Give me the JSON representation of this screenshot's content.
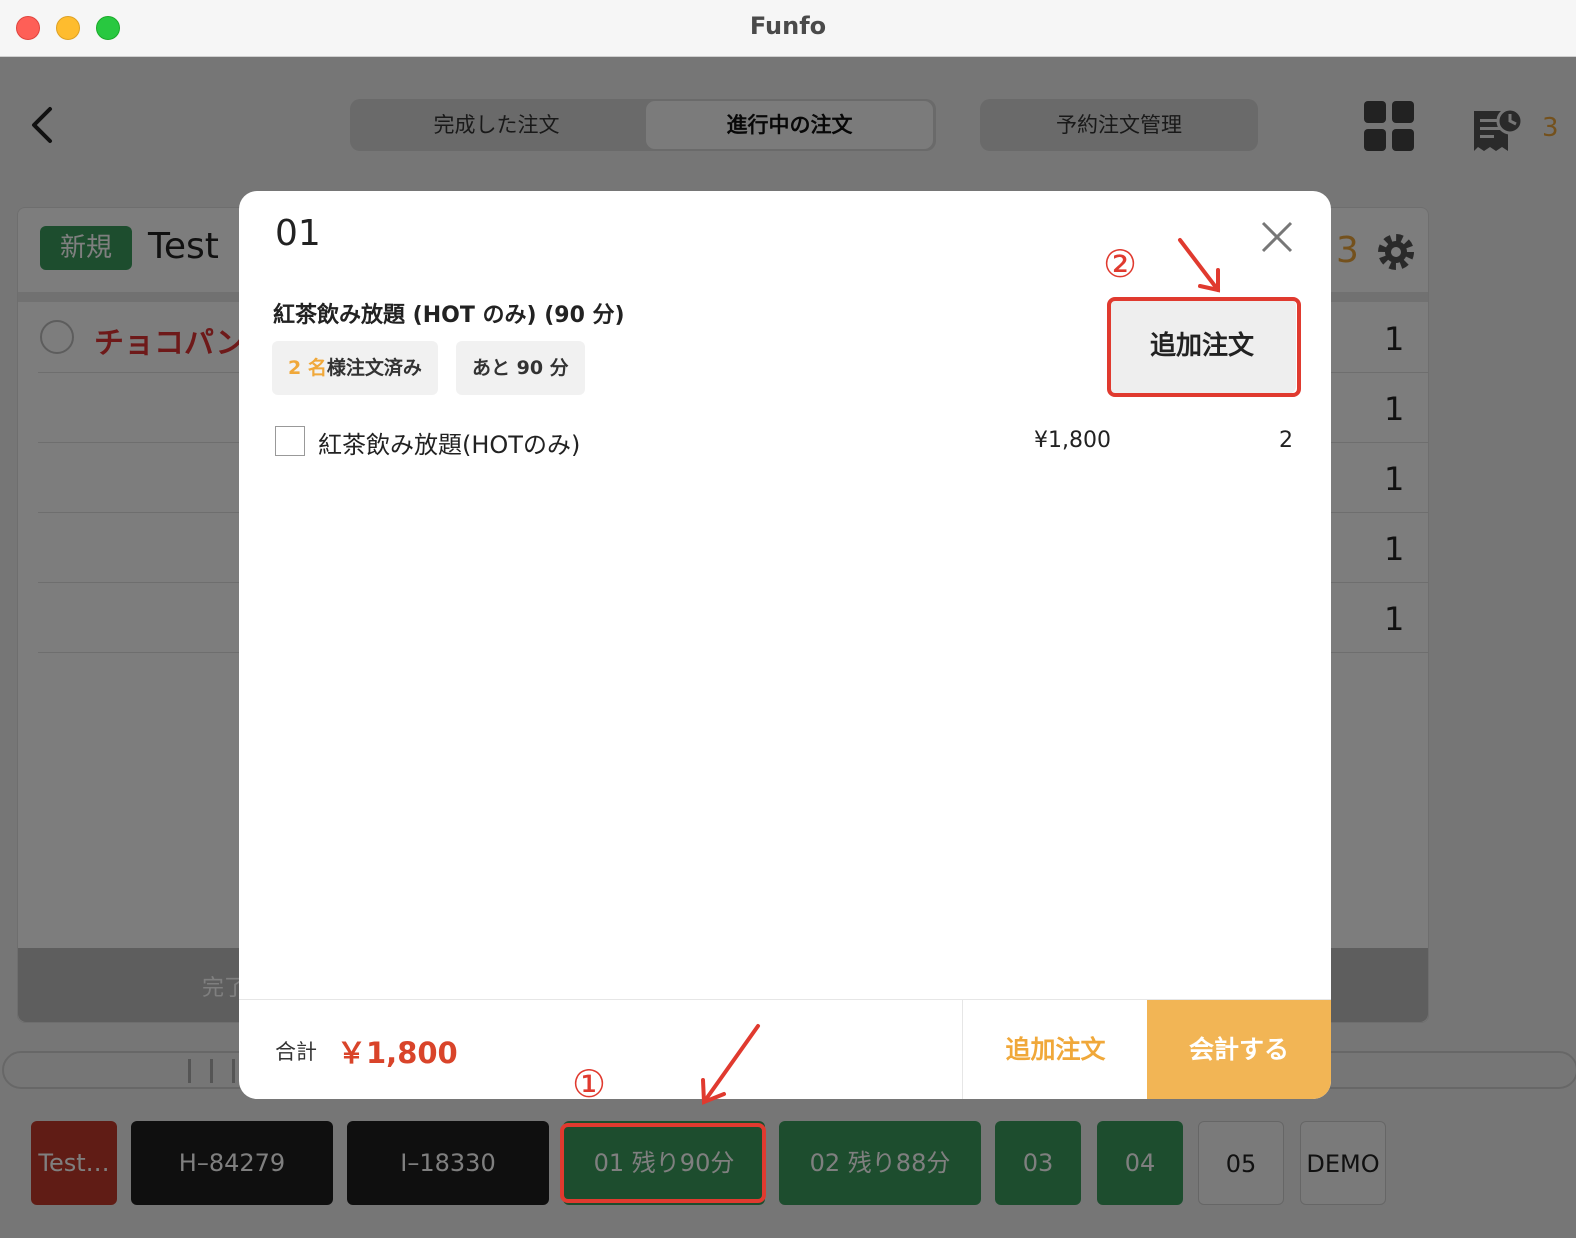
{
  "window": {
    "title": "Funfo"
  },
  "header": {
    "tabs": [
      {
        "label": "完成した注文"
      },
      {
        "label": "進行中の注文"
      }
    ],
    "reserve_label": "予約注文管理",
    "receipt_count": "3"
  },
  "order_card": {
    "badge": "新規",
    "title": "Test",
    "count": "3",
    "first_item": "チョコパンケ",
    "quantities": [
      "1",
      "1",
      "1",
      "1",
      "1"
    ],
    "footer_label": "完了"
  },
  "table_bar": [
    {
      "label": "Test…",
      "style": "red"
    },
    {
      "label": "H–84279",
      "style": "black"
    },
    {
      "label": "I–18330",
      "style": "black"
    },
    {
      "label": "01  残り90分",
      "style": "green"
    },
    {
      "label": "02  残り88分",
      "style": "green"
    },
    {
      "label": "03",
      "style": "green"
    },
    {
      "label": "04",
      "style": "green"
    },
    {
      "label": "05",
      "style": "white"
    },
    {
      "label": "DEMO",
      "style": "white"
    }
  ],
  "modal": {
    "title": "01",
    "course_name": "紅茶飲み放題 (HOT のみ) (90 分)",
    "people_count": "2 名",
    "people_suffix": "様注文済み",
    "remaining": "あと 90 分",
    "add_order_label": "追加注文",
    "items": [
      {
        "name": "紅茶飲み放題(HOTのみ)",
        "price": "¥1,800",
        "qty": "2"
      }
    ],
    "total_label": "合計",
    "total_value": "￥1,800",
    "footer_add_label": "追加注文",
    "footer_pay_label": "会計する"
  },
  "annotations": {
    "step1": "①",
    "step2": "②"
  },
  "colors": {
    "accent_orange": "#f2b555",
    "green": "#3a9a5c",
    "annotation_red": "#e03a2f"
  }
}
